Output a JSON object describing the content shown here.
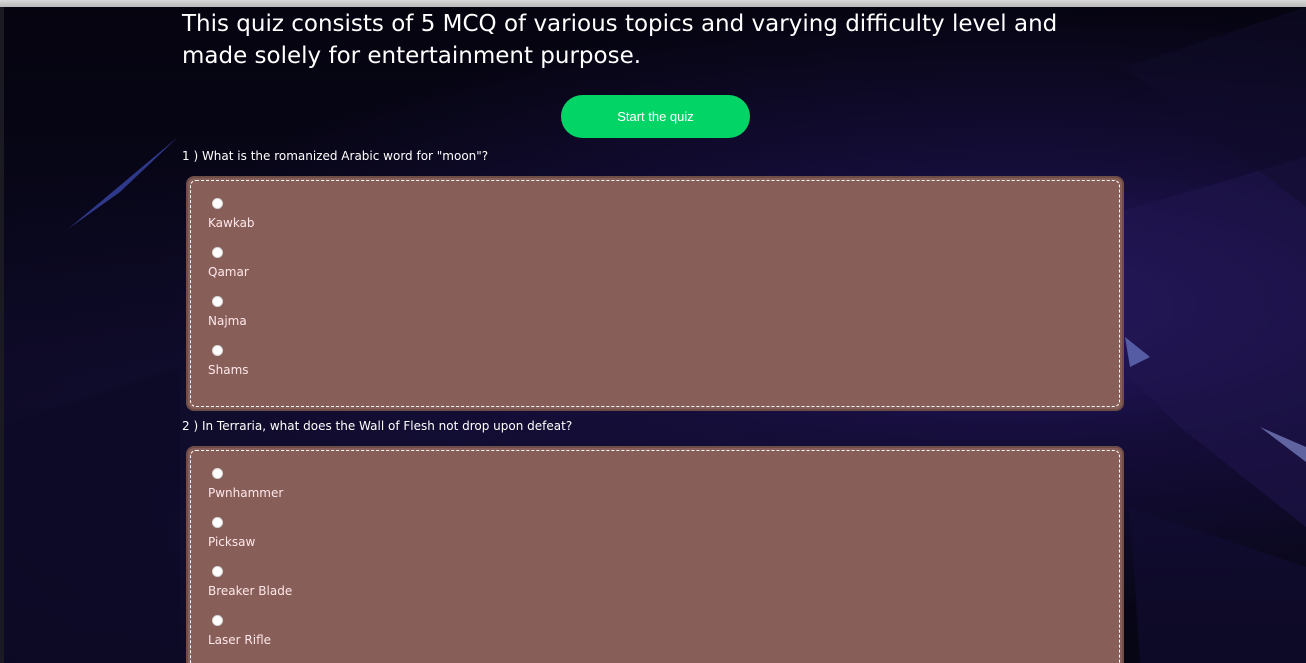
{
  "intro": {
    "text": "This quiz consists of 5 MCQ of various topics and varying difficulty level and made solely for entertainment purpose."
  },
  "start_button": {
    "label": "Start the quiz"
  },
  "questions": [
    {
      "label": "1 ) What is the romanized Arabic word for \"moon\"?",
      "options": [
        "Kawkab",
        "Qamar",
        "Najma",
        "Shams"
      ]
    },
    {
      "label": "2 ) In Terraria, what does the Wall of Flesh not drop upon defeat?",
      "options": [
        "Pwnhammer",
        "Picksaw",
        "Breaker Blade",
        "Laser Rifle"
      ]
    }
  ],
  "colors": {
    "background": "#04030f",
    "button": "#02d466",
    "option_box": "#875f58",
    "option_text": "#ffe6ea"
  }
}
